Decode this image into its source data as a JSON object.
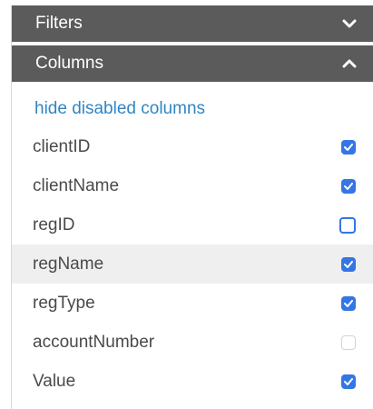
{
  "filters": {
    "label": "Filters",
    "icon": "chevron-down-icon"
  },
  "columns": {
    "label": "Columns",
    "icon": "chevron-up-icon"
  },
  "hide_disabled_label": "hide disabled columns",
  "colors": {
    "header_bg": "#5b5b5b",
    "link": "#2f86c6",
    "checkbox": "#3476e5",
    "highlight_row": "#efefef"
  },
  "rows": [
    {
      "label": "clientID",
      "state": "checked"
    },
    {
      "label": "clientName",
      "state": "checked"
    },
    {
      "label": "regID",
      "state": "unchecked"
    },
    {
      "label": "regName",
      "state": "checked",
      "highlighted": true
    },
    {
      "label": "regType",
      "state": "checked"
    },
    {
      "label": "accountNumber",
      "state": "disabled"
    },
    {
      "label": "Value",
      "state": "checked"
    }
  ]
}
